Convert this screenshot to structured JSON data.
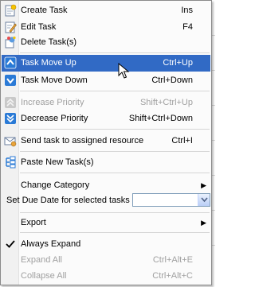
{
  "menu": {
    "items": [
      {
        "label": "Create Task",
        "shortcut": "Ins",
        "icon": "create-task-icon"
      },
      {
        "label": "Edit Task",
        "shortcut": "F4",
        "icon": "edit-task-icon"
      },
      {
        "label": "Delete Task(s)",
        "shortcut": "",
        "icon": "delete-task-icon"
      },
      {
        "label": "Task Move Up",
        "shortcut": "Ctrl+Up",
        "icon": "move-up-icon",
        "selected": true
      },
      {
        "label": "Task Move Down",
        "shortcut": "Ctrl+Down",
        "icon": "move-down-icon"
      },
      {
        "label": "Increase Priority",
        "shortcut": "Shift+Ctrl+Up",
        "icon": "increase-priority-icon",
        "disabled": true
      },
      {
        "label": "Decrease Priority",
        "shortcut": "Shift+Ctrl+Down",
        "icon": "decrease-priority-icon"
      },
      {
        "label": "Send task to assigned resource",
        "shortcut": "Ctrl+I",
        "icon": "send-task-icon"
      },
      {
        "label": "Paste New Task(s)",
        "shortcut": "",
        "icon": "paste-task-icon"
      },
      {
        "label": "Change Category",
        "shortcut": "",
        "submenu": true
      },
      {
        "label": "Set Due Date for selected tasks",
        "combo_value": ""
      },
      {
        "label": "Export",
        "shortcut": "",
        "submenu": true
      },
      {
        "label": "Always Expand",
        "shortcut": "",
        "checked": true,
        "icon": "check-icon"
      },
      {
        "label": "Expand All",
        "shortcut": "Ctrl+Alt+E",
        "disabled": true
      },
      {
        "label": "Collapse All",
        "shortcut": "Ctrl+Alt+C",
        "disabled": true
      }
    ]
  },
  "colors": {
    "highlight": "#316ac5",
    "disabled_text": "#a0a0a0",
    "menu_bg": "#fbfbfb",
    "icon_blue": "#2a7ad6"
  }
}
